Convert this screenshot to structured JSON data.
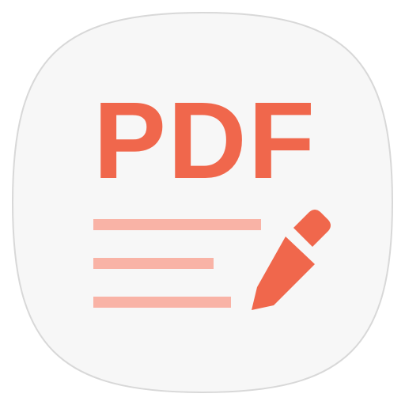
{
  "icon": {
    "text": "PDF",
    "icon_name": "pdf-writer-app-icon",
    "colors": {
      "background": "#f7f7f7",
      "outline": "#d8d8d8",
      "text": "#f0674c",
      "lines": "#f9b3a6",
      "pencil": "#f0674c"
    }
  }
}
